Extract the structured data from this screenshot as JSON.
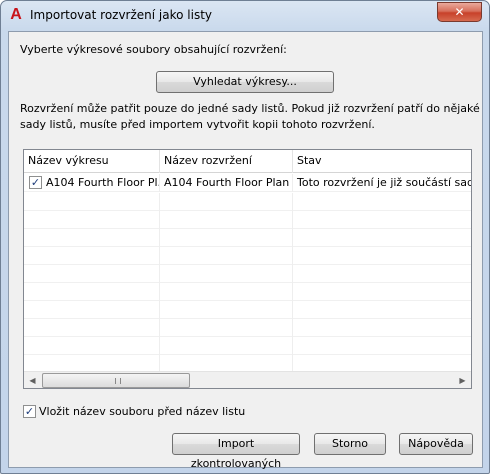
{
  "window": {
    "title": "Importovat rozvržení jako listy",
    "app_icon": "A",
    "close_glyph": "✕"
  },
  "instructions": {
    "select_label": "Vyberte výkresové soubory obsahující rozvržení:",
    "find_button": "Vyhledat výkresy...",
    "info_text": "Rozvržení může patřit pouze do jedné sady listů. Pokud již rozvržení patří do nějaké sady listů, musíte před importem vytvořit kopii tohoto rozvržení."
  },
  "table": {
    "columns": [
      "Název výkresu",
      "Název rozvržení",
      "Stav"
    ],
    "rows": [
      {
        "checked": true,
        "drawing": "A104 Fourth Floor Pl...",
        "layout": "A104 Fourth Floor Plan",
        "status": "Toto rozvržení je již součástí sady listů"
      }
    ],
    "empty_rows": 10
  },
  "options": {
    "prefix_checkbox_checked": true,
    "prefix_label": "Vložit název souboru před název listu"
  },
  "buttons": {
    "import": "Import zkontrolovaných",
    "cancel": "Storno",
    "help": "Nápověda"
  },
  "icons": {
    "app": "autocad-logo-icon",
    "close": "close-icon",
    "check": "checkmark-icon",
    "scroll_left": "arrow-left-icon",
    "scroll_right": "arrow-right-icon"
  },
  "colors": {
    "window_frame": "#c3d4ea",
    "close_button": "#c8412a",
    "dialog_bg": "#f0f0f0",
    "app_icon_red": "#c8141b"
  }
}
